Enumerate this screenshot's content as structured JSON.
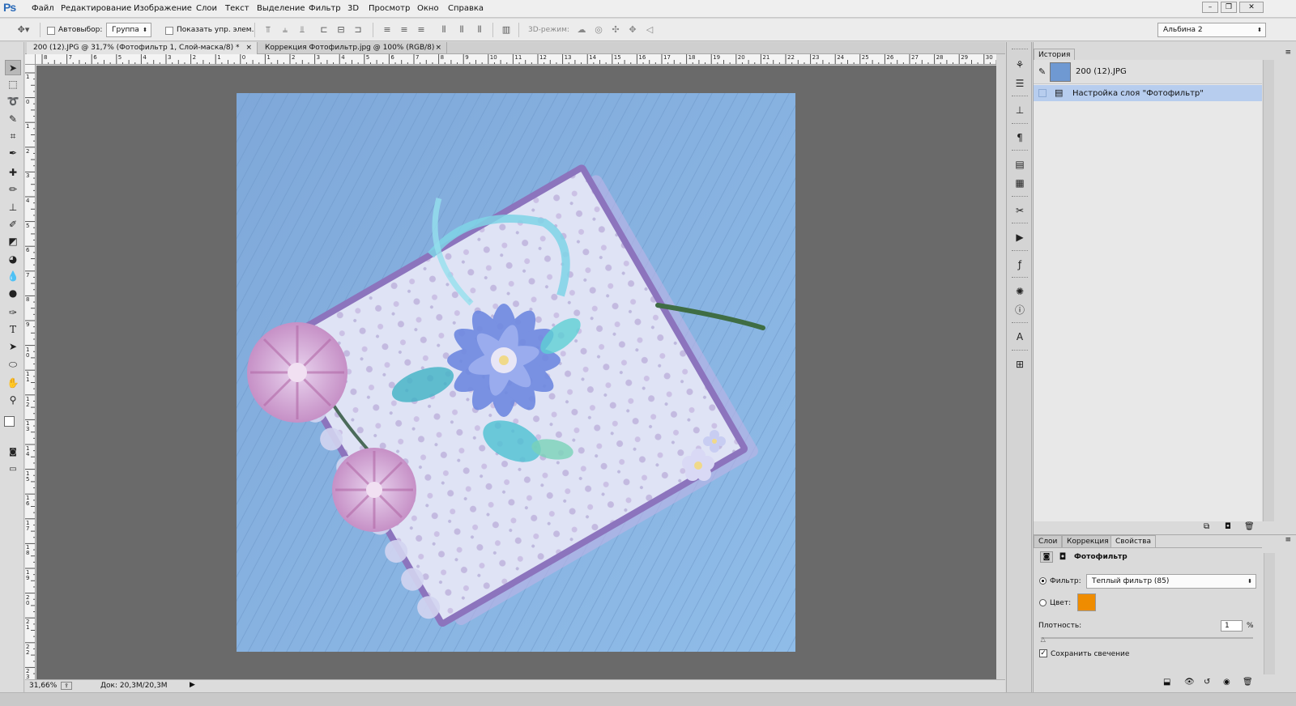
{
  "app": {
    "logo": "Ps"
  },
  "menu": [
    "Файл",
    "Редактирование",
    "Изображение",
    "Слои",
    "Текст",
    "Выделение",
    "Фильтр",
    "3D",
    "Просмотр",
    "Окно",
    "Справка"
  ],
  "window_controls": {
    "minimize": "–",
    "restore": "❐",
    "close": "✕"
  },
  "options": {
    "autoselect_label": "Автовыбор:",
    "autoselect_value": "Группа",
    "show_transform_label": "Показать упр. элем.",
    "mode3d_label": "3D-режим:",
    "workspace": "Альбина 2"
  },
  "tabs": [
    {
      "label": "200 (12).JPG @ 31,7% (Фотофильтр 1, Слой-маска/8) *",
      "close": "×",
      "active": true
    },
    {
      "label": "Коррекция Фотофильтр.jpg @ 100% (RGB/8)",
      "close": "×",
      "active": false
    }
  ],
  "ruler": {
    "h_labels": [
      "8",
      "7",
      "6",
      "5",
      "4",
      "3",
      "2",
      "1",
      "0",
      "1",
      "2",
      "3",
      "4",
      "5",
      "6",
      "7",
      "8",
      "9",
      "10",
      "11",
      "12",
      "13",
      "14",
      "15",
      "16",
      "17",
      "18",
      "19",
      "20",
      "21",
      "22",
      "23",
      "24",
      "25",
      "26",
      "27",
      "28",
      "29",
      "30"
    ],
    "v_labels": [
      "1",
      "0",
      "1",
      "2",
      "3",
      "4",
      "5",
      "6",
      "7",
      "8",
      "9",
      "10",
      "11",
      "12",
      "13",
      "14",
      "15",
      "16",
      "17",
      "18",
      "19",
      "20",
      "21",
      "22",
      "23"
    ]
  },
  "status": {
    "zoom": "31,66%",
    "doc": "Док: 20,3M/20,3M"
  },
  "history": {
    "tab": "История",
    "snapshot": "200 (12).JPG",
    "items": [
      "Настройка слоя \"Фотофильтр\""
    ]
  },
  "properties": {
    "tabs": [
      "Слои",
      "Коррекция",
      "Свойства"
    ],
    "title": "Фотофильтр",
    "filter_label": "Фильтр:",
    "filter_value": "Теплый фильтр (85)",
    "color_label": "Цвет:",
    "density_label": "Плотность:",
    "density_value": "1",
    "density_unit": "%",
    "density_level": 0.01,
    "preserve_label": "Сохранить свечение",
    "preserve_checked": true
  },
  "colors": {
    "filter_swatch": "#ef8c00",
    "history_selected": "#b7cdee"
  }
}
